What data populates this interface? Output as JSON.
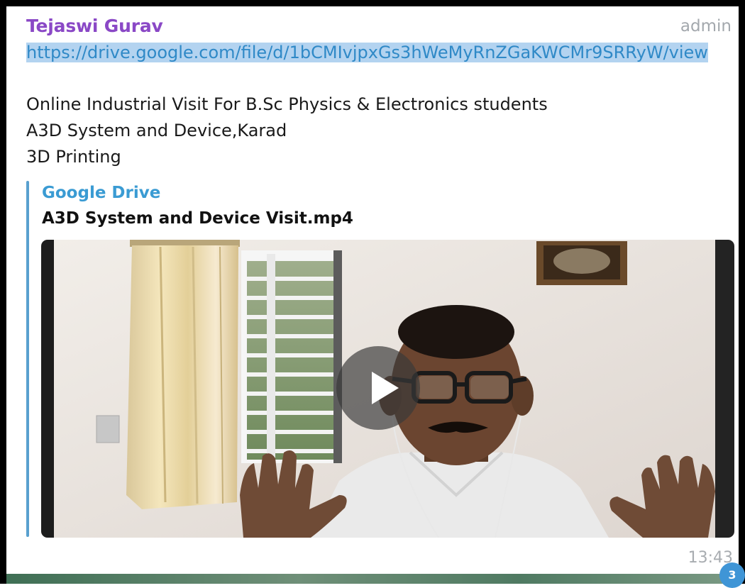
{
  "message": {
    "sender_name": "Tejaswi Gurav",
    "sender_role": "admin",
    "link_url": "https://drive.google.com/file/d/1bCMIvjpxGs3hWeMyRnZGaKWCMr9SRRyW/view",
    "text_lines": [
      "Online Industrial Visit For B.Sc Physics & Electronics students",
      "A3D System and Device,Karad",
      "3D Printing"
    ],
    "time": "13:43"
  },
  "link_preview": {
    "site_name": "Google Drive",
    "title": "A3D System and Device Visit.mp4"
  },
  "video": {
    "play_icon": "play-icon"
  },
  "badge": {
    "count": "3"
  },
  "colors": {
    "sender": "#8a48c6",
    "link": "#2f89c7",
    "link_highlight": "#b3d3f0",
    "preview_accent": "#59a0cf",
    "preview_site": "#3a9bd3",
    "badge": "#3f95d6"
  }
}
